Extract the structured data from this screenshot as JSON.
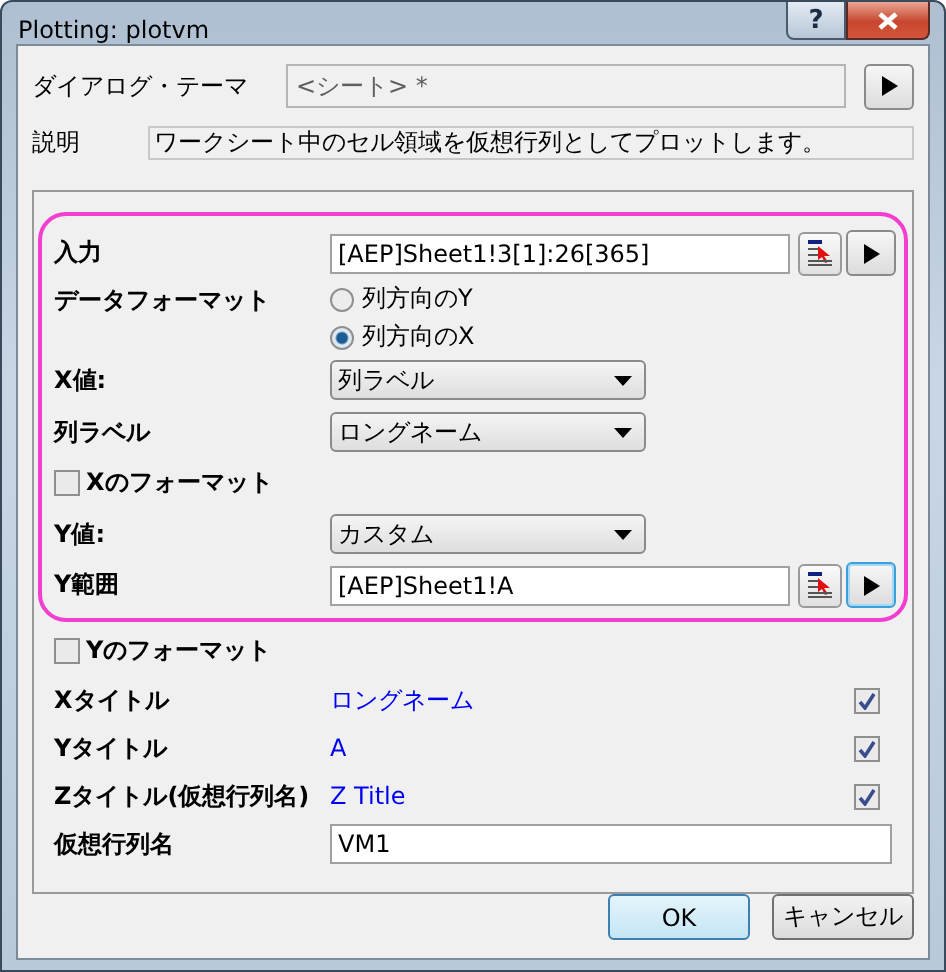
{
  "window": {
    "title": "Plotting: plotvm",
    "help": "?"
  },
  "theme": {
    "label": "ダイアログ・テーマ",
    "value": "<シート> *"
  },
  "description": {
    "label": "説明",
    "text": "ワークシート中のセル領域を仮想行列としてプロットします。"
  },
  "highlighted_rows": [
    {
      "kind": "range",
      "label": "入力",
      "value": "[AEP]Sheet1!3[1]:26[365]",
      "focused": false
    },
    {
      "kind": "radio",
      "label": "データフォーマット",
      "options": [
        {
          "label": "列方向のY",
          "selected": false
        },
        {
          "label": "列方向のX",
          "selected": true
        }
      ]
    },
    {
      "kind": "dropdown",
      "label": "X値:",
      "value": "列ラベル"
    },
    {
      "kind": "dropdown",
      "label": "列ラベル",
      "value": "ロングネーム"
    },
    {
      "kind": "checkbox",
      "label": "Xのフォーマット",
      "checked": false
    },
    {
      "kind": "dropdown",
      "label": "Y値:",
      "value": "カスタム"
    },
    {
      "kind": "range",
      "label": "Y範囲",
      "value": "[AEP]Sheet1!A",
      "focused": true
    }
  ],
  "rows": [
    {
      "kind": "checkbox",
      "label": "Yのフォーマット",
      "checked": false
    },
    {
      "kind": "title",
      "label": "Xタイトル",
      "value": "ロングネーム",
      "checked": true
    },
    {
      "kind": "title",
      "label": "Yタイトル",
      "value": "A",
      "checked": true
    },
    {
      "kind": "title",
      "label": "Zタイトル(仮想行列名)",
      "value": "Z Title",
      "checked": true
    },
    {
      "kind": "text",
      "label": "仮想行列名",
      "value": "VM1"
    }
  ],
  "buttons": [
    {
      "label": "OK",
      "default": true
    },
    {
      "label": "キャンセル",
      "default": false
    }
  ]
}
